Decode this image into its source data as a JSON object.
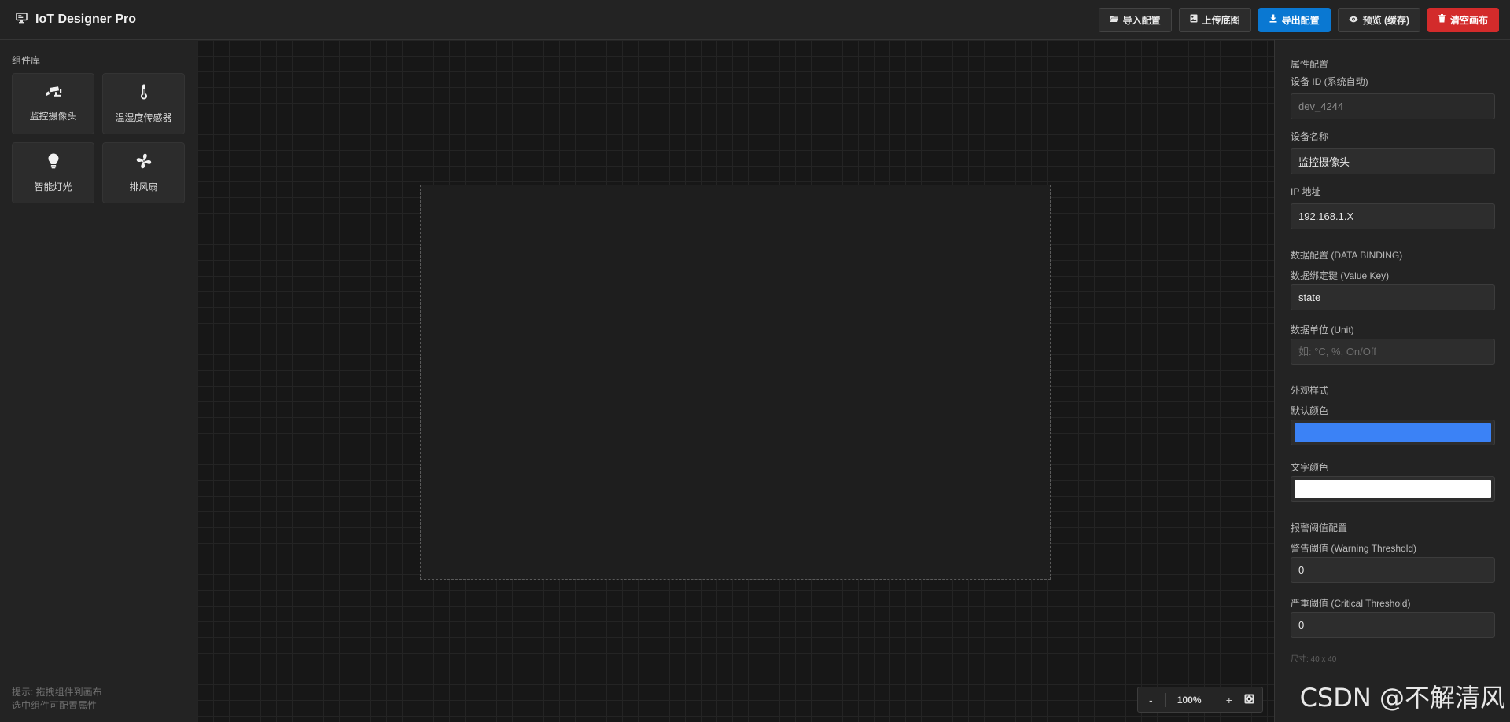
{
  "header": {
    "title": "IoT Designer Pro",
    "buttons": {
      "import": "导入配置",
      "upload_bg": "上传底图",
      "export": "导出配置",
      "preview": "预览 (缓存)",
      "clear": "清空画布"
    }
  },
  "sidebar": {
    "title": "组件库",
    "components": [
      {
        "label": "监控摄像头",
        "icon": "cctv-camera-icon"
      },
      {
        "label": "温湿度传感器",
        "icon": "thermometer-icon"
      },
      {
        "label": "智能灯光",
        "icon": "lightbulb-icon"
      },
      {
        "label": "排风扇",
        "icon": "fan-icon"
      }
    ],
    "hint_line1": "提示: 拖拽组件到画布",
    "hint_line2": "选中组件可配置属性"
  },
  "canvas": {
    "zoom_minus": "-",
    "zoom_level": "100%",
    "zoom_plus": "+"
  },
  "props": {
    "title": "属性配置",
    "device_id_label": "设备 ID (系统自动)",
    "device_id": "dev_4244",
    "device_name_label": "设备名称",
    "device_name": "监控摄像头",
    "ip_label": "IP 地址",
    "ip": "192.168.1.X",
    "data_section": "数据配置 (DATA BINDING)",
    "value_key_label": "数据绑定键 (Value Key)",
    "value_key": "state",
    "unit_label": "数据单位 (Unit)",
    "unit_placeholder": "如: °C, %, On/Off",
    "style_section": "外观样式",
    "default_color_label": "默认颜色",
    "default_color": "#3b82f6",
    "text_color_label": "文字颜色",
    "text_color": "#ffffff",
    "alarm_section": "报警阈值配置",
    "warning_label": "警告阈值 (Warning Threshold)",
    "warning": "0",
    "critical_label": "严重阈值 (Critical Threshold)",
    "critical": "0",
    "size_note": "尺寸: 40 x 40"
  },
  "watermark": "CSDN @不解清风"
}
